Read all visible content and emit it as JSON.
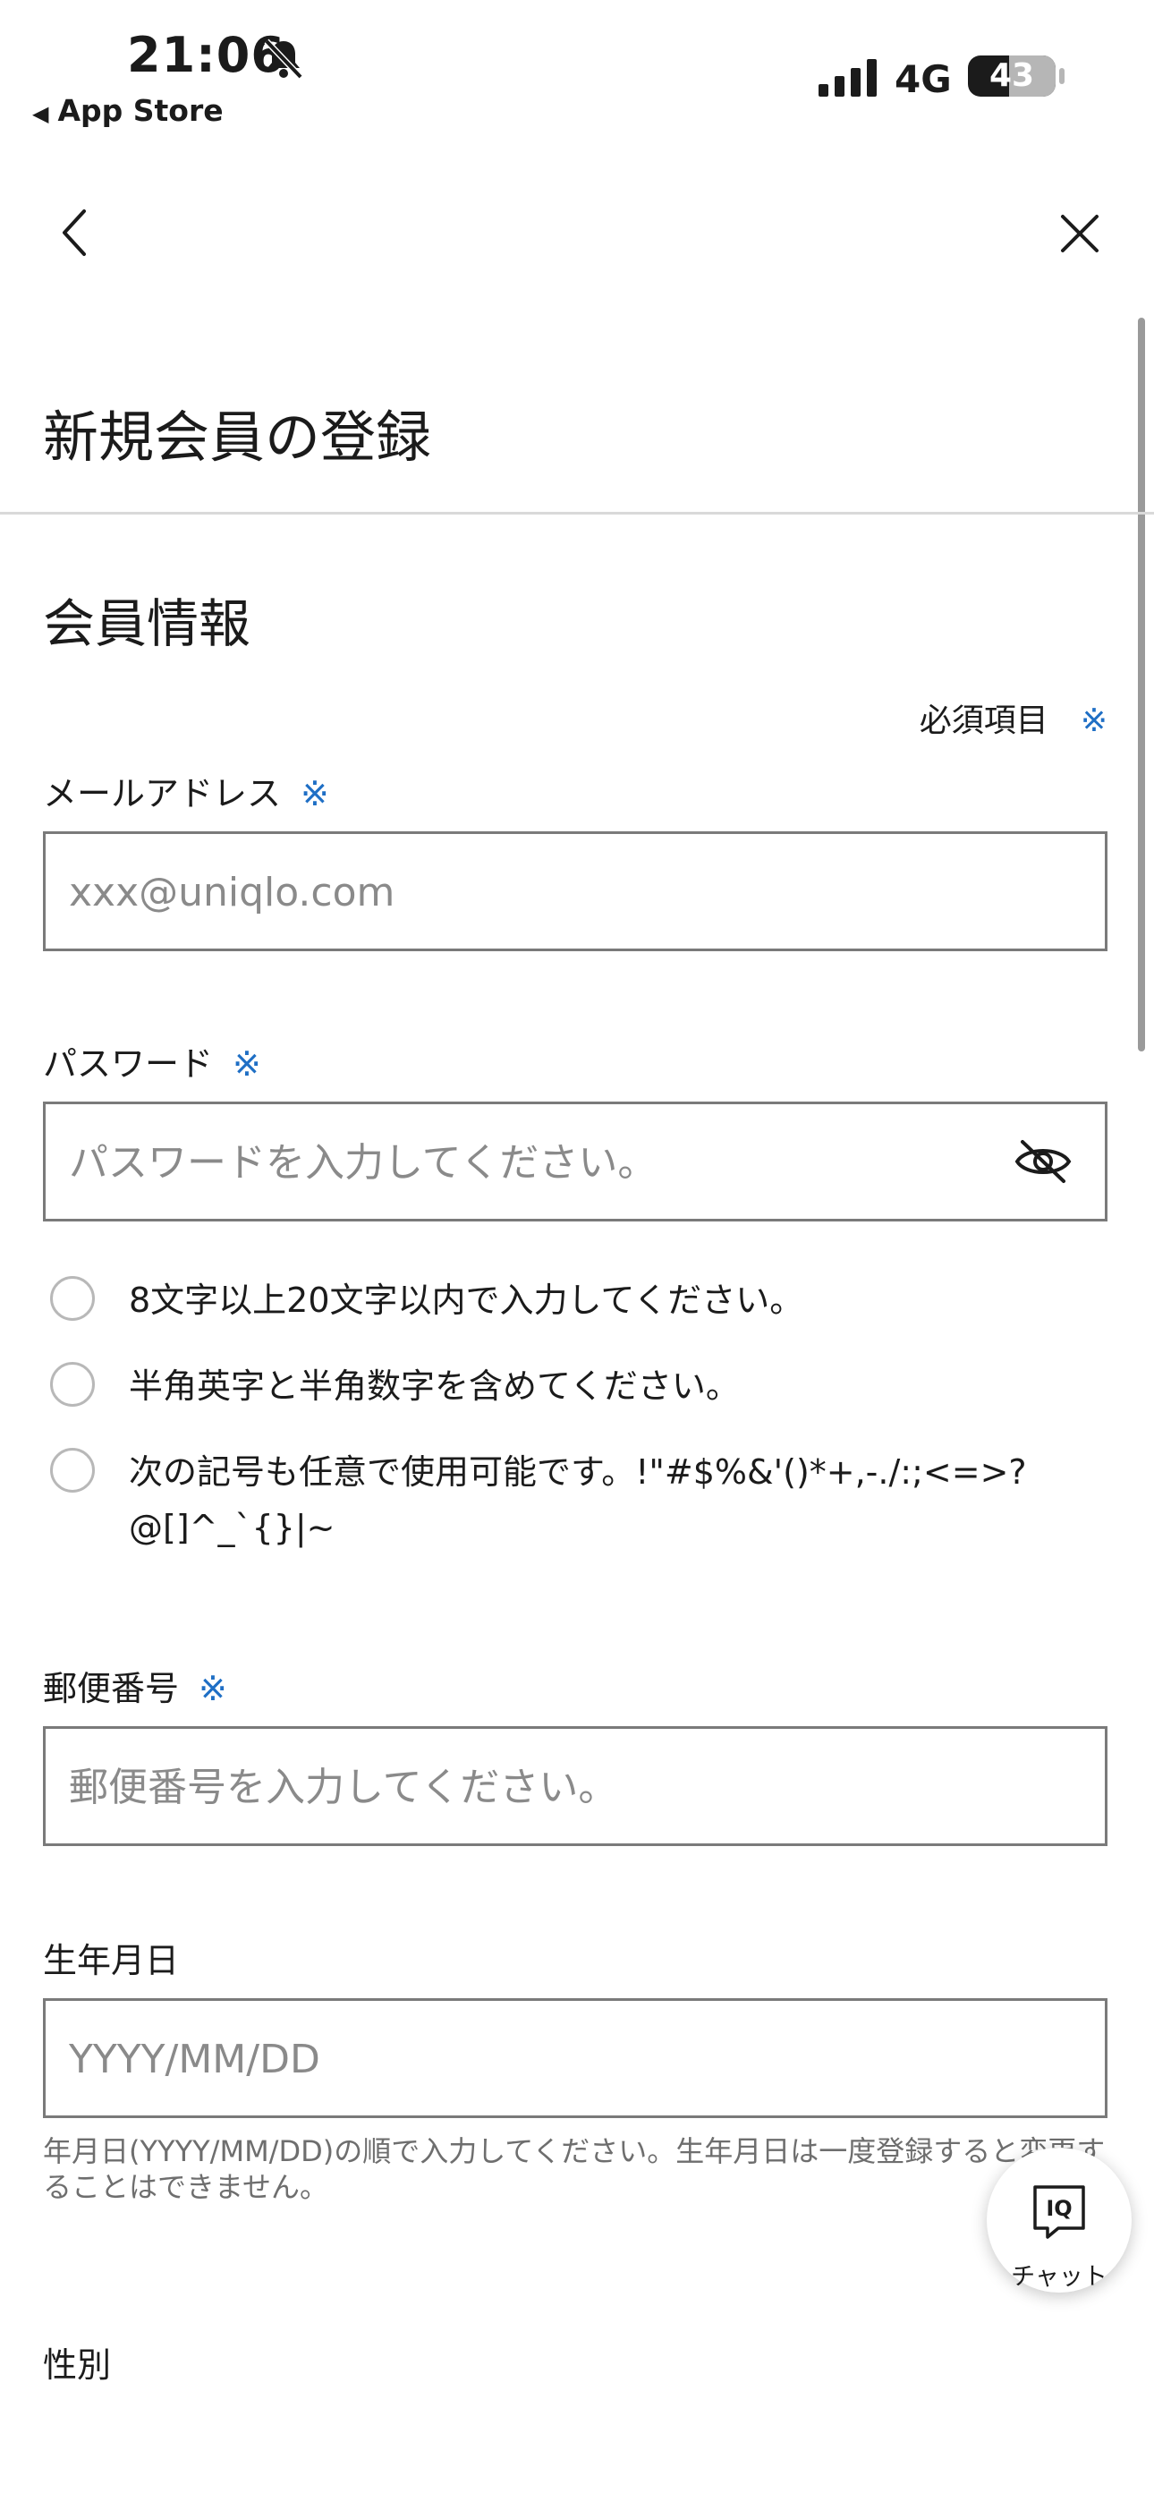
{
  "status_bar": {
    "time": "21:06",
    "back_app": "App Store",
    "network": "4G",
    "battery": "43"
  },
  "page": {
    "title": "新規会員の登録",
    "section_title": "会員情報",
    "required_note": "必須項目",
    "required_mark": "※"
  },
  "form": {
    "email": {
      "label": "メールアドレス",
      "placeholder": "xxx@uniqlo.com"
    },
    "password": {
      "label": "パスワード",
      "placeholder": "パスワードを入力してください。",
      "rules": [
        "8文字以上20文字以内で入力してください。",
        "半角英字と半角数字を含めてください。",
        "次の記号も任意で使用可能です。!\"#$%&'()*+,-./:;<=>?@[]^_`{}|~"
      ]
    },
    "postal": {
      "label": "郵便番号",
      "placeholder": "郵便番号を入力してください。"
    },
    "birthday": {
      "label": "生年月日",
      "placeholder": "YYYY/MM/DD",
      "hint": "年月日(YYYY/MM/DD)の順で入力してください。生年月日は一度登録すると変更することはできません。"
    },
    "gender": {
      "label": "性別"
    }
  },
  "chat": {
    "label": "チャット",
    "logo": "IQ"
  },
  "colors": {
    "accent": "#1f6fc5",
    "border": "#7a7a7a",
    "placeholder": "#8a8a8a"
  },
  "icons": {
    "bell": "bell-slash-icon",
    "back": "chevron-left-icon",
    "close": "close-icon",
    "eye": "eye-slash-icon",
    "chat": "iq-chat-icon"
  }
}
